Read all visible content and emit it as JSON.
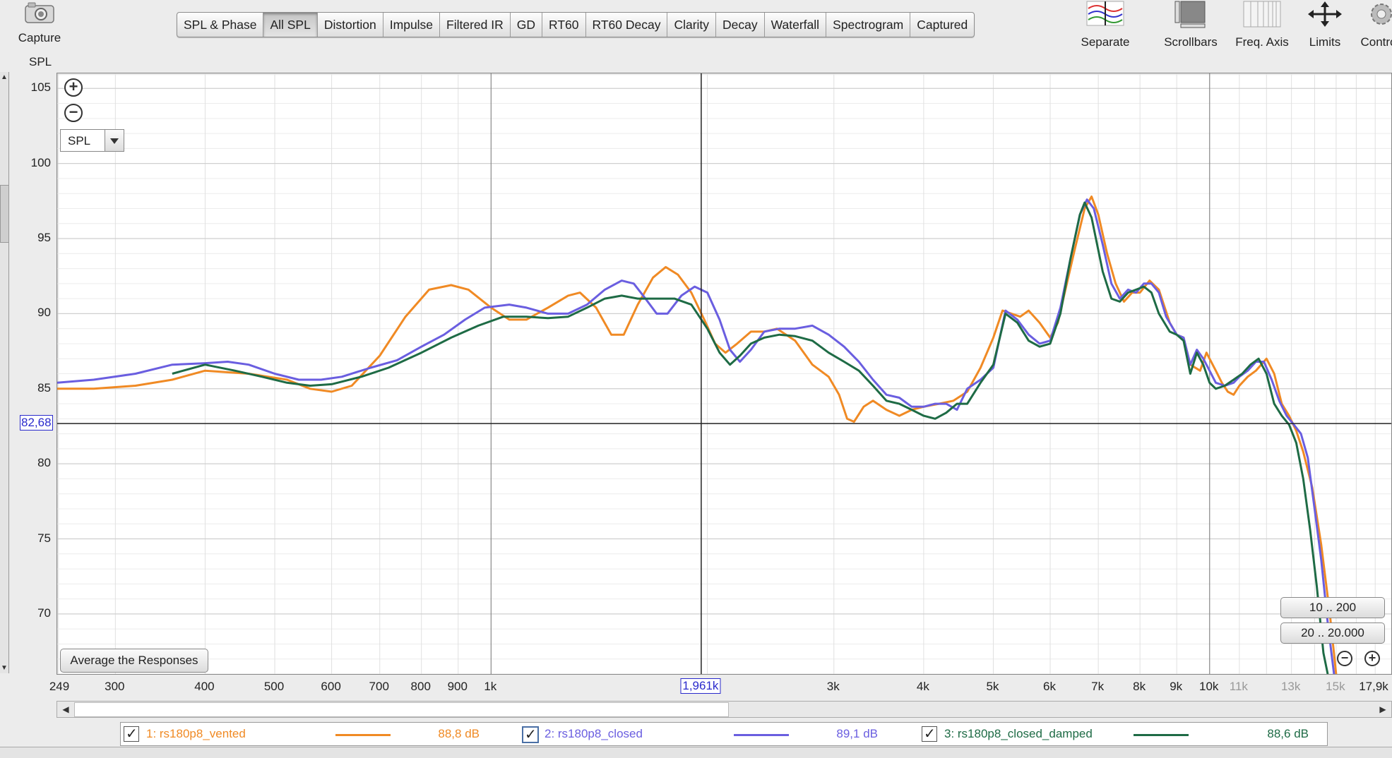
{
  "toolbar": {
    "capture_label": "Capture",
    "tabs": [
      "SPL & Phase",
      "All SPL",
      "Distortion",
      "Impulse",
      "Filtered IR",
      "GD",
      "RT60",
      "RT60 Decay",
      "Clarity",
      "Decay",
      "Waterfall",
      "Spectrogram",
      "Captured"
    ],
    "active_tab": "All SPL",
    "tools": [
      "Separate",
      "Scrollbars",
      "Freq. Axis",
      "Limits",
      "Contro"
    ]
  },
  "graph": {
    "y_unit": "SPL",
    "selector_value": "SPL",
    "average_button": "Average the Responses",
    "range_buttons": [
      "10 .. 200",
      "20 .. 20.000"
    ]
  },
  "cursor": {
    "x_readout": "1,961k",
    "y_readout": "82,68",
    "x_value": 1961,
    "y_value": 82.68
  },
  "chart_data": {
    "type": "line",
    "title": "",
    "xlabel": "",
    "ylabel": "SPL",
    "x_scale": "log",
    "xlim": [
      249,
      17900
    ],
    "ylim": [
      66,
      106
    ],
    "grid": true,
    "y_ticks": [
      105,
      100,
      95,
      90,
      85,
      80,
      75,
      70
    ],
    "x_ticks": [
      {
        "value": 249,
        "label": "249"
      },
      {
        "value": 300,
        "label": "300"
      },
      {
        "value": 400,
        "label": "400"
      },
      {
        "value": 500,
        "label": "500"
      },
      {
        "value": 600,
        "label": "600"
      },
      {
        "value": 700,
        "label": "700"
      },
      {
        "value": 800,
        "label": "800"
      },
      {
        "value": 900,
        "label": "900"
      },
      {
        "value": 1000,
        "label": "1k"
      },
      {
        "value": 3000,
        "label": "3k"
      },
      {
        "value": 4000,
        "label": "4k"
      },
      {
        "value": 5000,
        "label": "5k"
      },
      {
        "value": 6000,
        "label": "6k"
      },
      {
        "value": 7000,
        "label": "7k"
      },
      {
        "value": 8000,
        "label": "8k"
      },
      {
        "value": 9000,
        "label": "9k"
      },
      {
        "value": 10000,
        "label": "10k"
      },
      {
        "value": 11000,
        "label": "11k",
        "muted": true
      },
      {
        "value": 13000,
        "label": "13k",
        "muted": true
      },
      {
        "value": 15000,
        "label": "15k",
        "muted": true
      },
      {
        "value": 17900,
        "label": "17,9k"
      }
    ],
    "series": [
      {
        "name": "1: rs180p8_vented",
        "color": "#f08a24",
        "level": "88,8 dB",
        "points": [
          [
            249,
            85.0
          ],
          [
            280,
            85.0
          ],
          [
            320,
            85.2
          ],
          [
            360,
            85.6
          ],
          [
            400,
            86.2
          ],
          [
            460,
            86.0
          ],
          [
            520,
            85.6
          ],
          [
            560,
            85.0
          ],
          [
            600,
            84.8
          ],
          [
            640,
            85.2
          ],
          [
            700,
            87.2
          ],
          [
            760,
            89.8
          ],
          [
            820,
            91.6
          ],
          [
            880,
            91.9
          ],
          [
            930,
            91.6
          ],
          [
            1000,
            90.4
          ],
          [
            1060,
            89.6
          ],
          [
            1120,
            89.6
          ],
          [
            1200,
            90.4
          ],
          [
            1280,
            91.2
          ],
          [
            1330,
            91.4
          ],
          [
            1400,
            90.4
          ],
          [
            1470,
            88.6
          ],
          [
            1530,
            88.6
          ],
          [
            1600,
            90.6
          ],
          [
            1680,
            92.4
          ],
          [
            1750,
            93.1
          ],
          [
            1820,
            92.6
          ],
          [
            1900,
            91.4
          ],
          [
            1980,
            89.6
          ],
          [
            2050,
            88.0
          ],
          [
            2120,
            87.4
          ],
          [
            2200,
            88.0
          ],
          [
            2300,
            88.8
          ],
          [
            2400,
            88.8
          ],
          [
            2500,
            89.0
          ],
          [
            2650,
            88.2
          ],
          [
            2800,
            86.6
          ],
          [
            2950,
            85.8
          ],
          [
            3050,
            84.6
          ],
          [
            3130,
            83.0
          ],
          [
            3200,
            82.8
          ],
          [
            3300,
            83.8
          ],
          [
            3400,
            84.2
          ],
          [
            3550,
            83.6
          ],
          [
            3700,
            83.2
          ],
          [
            3850,
            83.6
          ],
          [
            4000,
            83.8
          ],
          [
            4200,
            84.0
          ],
          [
            4400,
            84.2
          ],
          [
            4600,
            84.8
          ],
          [
            4800,
            86.4
          ],
          [
            5000,
            88.4
          ],
          [
            5150,
            90.2
          ],
          [
            5300,
            90.0
          ],
          [
            5450,
            89.8
          ],
          [
            5600,
            90.2
          ],
          [
            5800,
            89.4
          ],
          [
            6000,
            88.4
          ],
          [
            6150,
            89.4
          ],
          [
            6300,
            91.6
          ],
          [
            6500,
            94.4
          ],
          [
            6700,
            97.0
          ],
          [
            6850,
            97.8
          ],
          [
            7000,
            96.6
          ],
          [
            7200,
            94.0
          ],
          [
            7400,
            92.0
          ],
          [
            7600,
            90.8
          ],
          [
            7800,
            91.4
          ],
          [
            8000,
            91.4
          ],
          [
            8250,
            92.2
          ],
          [
            8500,
            91.6
          ],
          [
            8800,
            89.4
          ],
          [
            9000,
            88.6
          ],
          [
            9200,
            88.4
          ],
          [
            9400,
            86.6
          ],
          [
            9700,
            86.2
          ],
          [
            9900,
            87.4
          ],
          [
            10200,
            86.2
          ],
          [
            10400,
            85.4
          ],
          [
            10600,
            84.8
          ],
          [
            10800,
            84.6
          ],
          [
            11000,
            85.2
          ],
          [
            11300,
            85.8
          ],
          [
            11600,
            86.2
          ],
          [
            12000,
            87.0
          ],
          [
            12300,
            86.0
          ],
          [
            12600,
            84.0
          ],
          [
            12900,
            83.2
          ],
          [
            13200,
            82.2
          ],
          [
            13500,
            80.8
          ],
          [
            13900,
            78.4
          ],
          [
            14300,
            74.6
          ],
          [
            14700,
            70.0
          ],
          [
            15000,
            66.0
          ]
        ]
      },
      {
        "name": "2: rs180p8_closed",
        "color": "#6a5ee0",
        "level": "89,1 dB",
        "points": [
          [
            249,
            85.4
          ],
          [
            280,
            85.6
          ],
          [
            320,
            86.0
          ],
          [
            360,
            86.6
          ],
          [
            400,
            86.7
          ],
          [
            430,
            86.8
          ],
          [
            460,
            86.6
          ],
          [
            500,
            86.0
          ],
          [
            540,
            85.6
          ],
          [
            580,
            85.6
          ],
          [
            620,
            85.8
          ],
          [
            680,
            86.4
          ],
          [
            740,
            86.9
          ],
          [
            800,
            87.8
          ],
          [
            860,
            88.6
          ],
          [
            920,
            89.6
          ],
          [
            980,
            90.4
          ],
          [
            1060,
            90.6
          ],
          [
            1120,
            90.4
          ],
          [
            1200,
            90.0
          ],
          [
            1280,
            90.0
          ],
          [
            1360,
            90.6
          ],
          [
            1440,
            91.6
          ],
          [
            1520,
            92.2
          ],
          [
            1580,
            92.0
          ],
          [
            1640,
            91.0
          ],
          [
            1700,
            90.0
          ],
          [
            1760,
            90.0
          ],
          [
            1840,
            91.2
          ],
          [
            1920,
            91.8
          ],
          [
            2000,
            91.4
          ],
          [
            2080,
            89.6
          ],
          [
            2150,
            87.6
          ],
          [
            2220,
            86.8
          ],
          [
            2300,
            87.6
          ],
          [
            2400,
            88.8
          ],
          [
            2520,
            89.0
          ],
          [
            2650,
            89.0
          ],
          [
            2800,
            89.2
          ],
          [
            2950,
            88.6
          ],
          [
            3100,
            87.8
          ],
          [
            3250,
            86.8
          ],
          [
            3400,
            85.6
          ],
          [
            3550,
            84.6
          ],
          [
            3700,
            84.4
          ],
          [
            3850,
            83.8
          ],
          [
            4000,
            83.8
          ],
          [
            4150,
            84.0
          ],
          [
            4300,
            84.0
          ],
          [
            4450,
            83.6
          ],
          [
            4600,
            85.0
          ],
          [
            4800,
            85.6
          ],
          [
            5000,
            86.4
          ],
          [
            5200,
            90.2
          ],
          [
            5400,
            89.6
          ],
          [
            5600,
            88.6
          ],
          [
            5800,
            88.0
          ],
          [
            6000,
            88.2
          ],
          [
            6200,
            90.4
          ],
          [
            6400,
            93.6
          ],
          [
            6600,
            96.6
          ],
          [
            6750,
            97.6
          ],
          [
            6900,
            97.0
          ],
          [
            7100,
            94.6
          ],
          [
            7300,
            92.0
          ],
          [
            7500,
            91.0
          ],
          [
            7700,
            91.6
          ],
          [
            7900,
            91.4
          ],
          [
            8100,
            92.0
          ],
          [
            8300,
            92.0
          ],
          [
            8500,
            91.4
          ],
          [
            8700,
            89.8
          ],
          [
            9000,
            88.6
          ],
          [
            9200,
            88.4
          ],
          [
            9400,
            86.6
          ],
          [
            9600,
            87.6
          ],
          [
            9800,
            87.0
          ],
          [
            10000,
            86.2
          ],
          [
            10200,
            85.4
          ],
          [
            10500,
            85.2
          ],
          [
            10800,
            85.4
          ],
          [
            11000,
            85.8
          ],
          [
            11300,
            86.2
          ],
          [
            11600,
            86.8
          ],
          [
            11900,
            86.8
          ],
          [
            12200,
            85.6
          ],
          [
            12500,
            84.2
          ],
          [
            12800,
            83.2
          ],
          [
            13100,
            82.6
          ],
          [
            13400,
            82.0
          ],
          [
            13700,
            80.4
          ],
          [
            14000,
            77.0
          ],
          [
            14300,
            73.6
          ],
          [
            14600,
            69.4
          ],
          [
            14900,
            66.0
          ]
        ]
      },
      {
        "name": "3: rs180p8_closed_damped",
        "color": "#1e6b45",
        "level": "88,6 dB",
        "points": [
          [
            360,
            86.0
          ],
          [
            400,
            86.6
          ],
          [
            440,
            86.2
          ],
          [
            480,
            85.8
          ],
          [
            520,
            85.4
          ],
          [
            560,
            85.2
          ],
          [
            600,
            85.3
          ],
          [
            660,
            85.8
          ],
          [
            720,
            86.4
          ],
          [
            800,
            87.4
          ],
          [
            880,
            88.4
          ],
          [
            960,
            89.2
          ],
          [
            1040,
            89.8
          ],
          [
            1120,
            89.8
          ],
          [
            1200,
            89.7
          ],
          [
            1280,
            89.8
          ],
          [
            1360,
            90.4
          ],
          [
            1440,
            91.0
          ],
          [
            1520,
            91.2
          ],
          [
            1600,
            91.0
          ],
          [
            1700,
            91.0
          ],
          [
            1800,
            91.0
          ],
          [
            1900,
            90.6
          ],
          [
            2000,
            89.0
          ],
          [
            2080,
            87.4
          ],
          [
            2150,
            86.6
          ],
          [
            2220,
            87.2
          ],
          [
            2300,
            88.0
          ],
          [
            2400,
            88.4
          ],
          [
            2520,
            88.6
          ],
          [
            2650,
            88.5
          ],
          [
            2800,
            88.2
          ],
          [
            2950,
            87.4
          ],
          [
            3100,
            86.8
          ],
          [
            3250,
            86.2
          ],
          [
            3400,
            85.2
          ],
          [
            3550,
            84.2
          ],
          [
            3700,
            84.0
          ],
          [
            3850,
            83.6
          ],
          [
            4000,
            83.2
          ],
          [
            4150,
            83.0
          ],
          [
            4300,
            83.4
          ],
          [
            4450,
            84.0
          ],
          [
            4600,
            84.0
          ],
          [
            4800,
            85.4
          ],
          [
            5000,
            86.6
          ],
          [
            5200,
            90.0
          ],
          [
            5400,
            89.4
          ],
          [
            5600,
            88.2
          ],
          [
            5800,
            87.8
          ],
          [
            6000,
            88.0
          ],
          [
            6200,
            90.0
          ],
          [
            6400,
            93.6
          ],
          [
            6600,
            96.6
          ],
          [
            6700,
            97.4
          ],
          [
            6850,
            96.4
          ],
          [
            7100,
            92.8
          ],
          [
            7300,
            91.0
          ],
          [
            7500,
            90.8
          ],
          [
            7700,
            91.4
          ],
          [
            7900,
            91.6
          ],
          [
            8100,
            91.8
          ],
          [
            8300,
            91.4
          ],
          [
            8500,
            90.0
          ],
          [
            8800,
            88.8
          ],
          [
            9000,
            88.6
          ],
          [
            9200,
            88.2
          ],
          [
            9400,
            86.0
          ],
          [
            9600,
            87.4
          ],
          [
            9800,
            86.6
          ],
          [
            10000,
            85.4
          ],
          [
            10200,
            85.0
          ],
          [
            10500,
            85.2
          ],
          [
            10800,
            85.6
          ],
          [
            11100,
            86.0
          ],
          [
            11400,
            86.6
          ],
          [
            11700,
            87.0
          ],
          [
            12000,
            86.0
          ],
          [
            12300,
            84.0
          ],
          [
            12600,
            83.2
          ],
          [
            12900,
            82.6
          ],
          [
            13200,
            81.4
          ],
          [
            13500,
            79.0
          ],
          [
            13800,
            75.6
          ],
          [
            14100,
            71.8
          ],
          [
            14400,
            67.4
          ],
          [
            14600,
            66.0
          ]
        ]
      }
    ]
  }
}
